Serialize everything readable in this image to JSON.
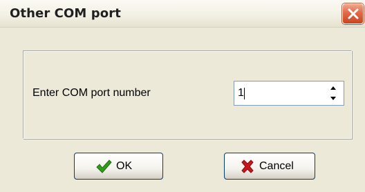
{
  "window": {
    "title": "Other COM port"
  },
  "form": {
    "prompt": "Enter COM port number",
    "port_value": "1"
  },
  "buttons": {
    "ok_label": "OK",
    "cancel_label": "Cancel"
  },
  "icons": {
    "close": "close-icon",
    "spin_up": "arrow-up-icon",
    "spin_down": "arrow-down-icon",
    "ok": "checkmark-icon",
    "cancel": "red-x-icon"
  },
  "colors": {
    "close_button": "#e2684a",
    "checkmark": "#2f9e1a",
    "cancel_x": "#c8161d"
  }
}
